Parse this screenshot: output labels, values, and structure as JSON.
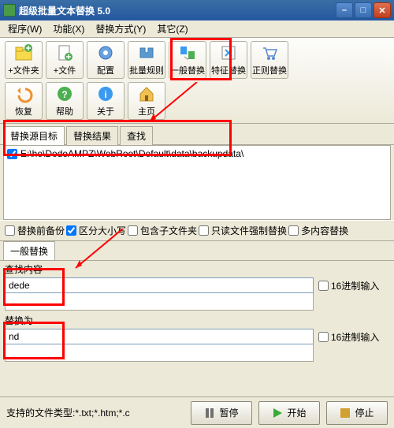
{
  "window": {
    "title": "超级批量文本替换  5.0"
  },
  "menu": {
    "program": "程序(W)",
    "function": "功能(X)",
    "replace_mode": "替换方式(Y)",
    "other": "其它(Z)"
  },
  "toolbar": {
    "row1": {
      "add_folder": "+文件夹",
      "add_file": "+文件",
      "config": "配置",
      "batch_rule": "批量规则",
      "general_replace": "一般替换",
      "feature_replace": "特征替换",
      "regex_replace": "正则替换"
    },
    "row2": {
      "recover": "恢复",
      "help": "帮助",
      "about": "关于",
      "home": "主页"
    }
  },
  "tabs": {
    "source": "替换源目标",
    "result": "替换结果",
    "find": "查找"
  },
  "source_list": {
    "items": [
      {
        "checked": true,
        "path": "E:\\he\\DedeAMPZ\\WebRoot\\Default\\data\\backupdata\\"
      }
    ]
  },
  "options": {
    "backup": "替换前备份",
    "backup_checked": false,
    "case": "区分大小写",
    "case_checked": true,
    "subfolder": "包含子文件夹",
    "subfolder_checked": false,
    "readonly": "只读文件强制替换",
    "readonly_checked": false,
    "multi": "多内容替换",
    "multi_checked": false
  },
  "mode_tab": "一般替换",
  "find": {
    "label": "查找内容",
    "value": "dede",
    "hex_label": "16进制输入",
    "hex_checked": false
  },
  "replace": {
    "label": "替换为",
    "value": "nd",
    "hex_label": "16进制输入",
    "hex_checked": false
  },
  "footer": {
    "supported": "支持的文件类型:*.txt;*.htm;*.c",
    "pause": "暂停",
    "start": "开始",
    "stop": "停止"
  }
}
